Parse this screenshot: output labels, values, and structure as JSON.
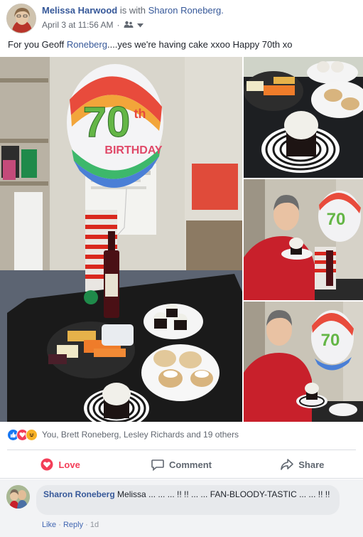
{
  "post": {
    "author": "Melissa Harwood",
    "with_text": "is with",
    "tagged": "Sharon Roneberg.",
    "date": "April 3 at 11:56 AM",
    "privacy_icon": "friends-icon",
    "text_before": "For you Geoff ",
    "text_link": "Roneberg",
    "text_after": "....yes we're having cake xxoo Happy 70th xo"
  },
  "photos": {
    "balloon_text": "70",
    "balloon_sub": "th",
    "balloon_banner": "BIRTHDAY"
  },
  "reactions": {
    "icons": [
      "like-icon",
      "love-icon",
      "haha-icon"
    ],
    "summary": "You, Brett Roneberg, Lesley Richards and 19 others"
  },
  "actions": {
    "love": "Love",
    "comment": "Comment",
    "share": "Share"
  },
  "comment": {
    "author": "Sharon Roneberg",
    "text": " Melissa ... ... ... !! !! ... ... FAN-BLOODY-TASTIC ... ... !! !!",
    "like": "Like",
    "reply": "Reply",
    "age": "1d",
    "separator": "·"
  },
  "colors": {
    "link": "#365899",
    "love": "#f33e58",
    "like": "#1877f2",
    "haha": "#f7b125"
  }
}
